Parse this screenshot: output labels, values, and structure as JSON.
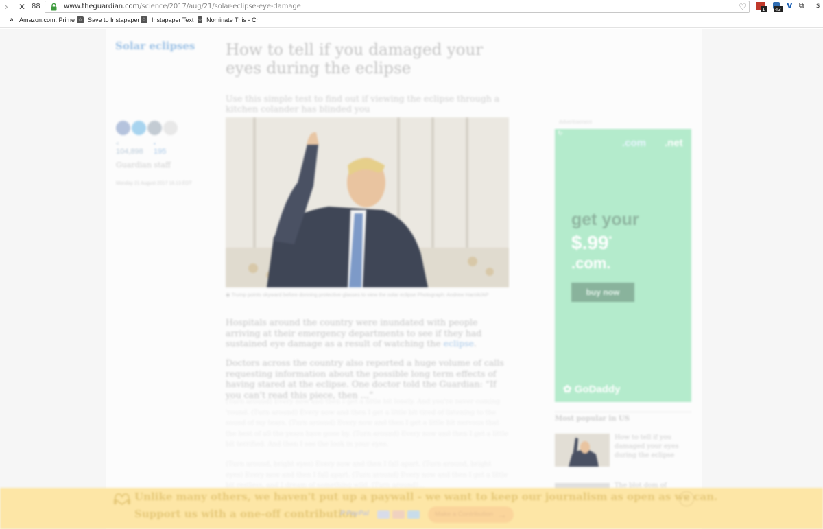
{
  "browser": {
    "url_host": "www.theguardian.com",
    "url_path": "/science/2017/aug/21/solar-eclipse-eye-damage",
    "ext_badges": [
      "1",
      "43",
      "",
      ""
    ],
    "bookmarks": [
      {
        "label": "Amazon.com: Prime",
        "icon": "a"
      },
      {
        "label": "Save to Instapaper",
        "icon": "☆"
      },
      {
        "label": "Instapaper Text",
        "icon": "☆"
      },
      {
        "label": "Nominate This - Chi",
        "icon": "☆"
      }
    ]
  },
  "article": {
    "section": "Solar eclipses",
    "headline": "How to tell if you damaged your eyes during the eclipse",
    "standfirst": "Use this simple test to find out if viewing the eclipse through a kitchen colander has blinded you",
    "shares": "104,898",
    "comments": "195",
    "byline": "Guardian staff",
    "date": "Monday 21 August 2017 16.13 EDT",
    "caption": "Trump points skyward before donning protective glasses to view the solar eclipse Photograph: Andrew Harnik/AP",
    "p1_before": "Hospitals around the country were inundated with people arriving at their emergency departments to see if they had sustained eye damage as a result of watching the ",
    "p1_link": "eclipse",
    "p1_after": ".",
    "p2": "Doctors across the country also reported a huge volume of calls requesting information about the possible long term effects of having stared at the eclipse. One doctor told the Guardian: “If you can’t read this piece, then …”",
    "p3": "(Turn around) Every now and then I get a little bit lonely. And you're never coming 'round. (Turn around) Every now and then I get a little bit tired of listening to the sound of my tears. (Turn around) Every now and then I get a little bit nervous that the best of all the years have gone by. (Turn around) Every now and then I get a little bit terrified. And then I see the look in your eyes.",
    "p4": "(Turn around, bright eyes) Every now and then I fall apart. (Turn around, bright eyes) Every now and then I fall apart. (Turn around) Every now and then I get a little bit restless, and I dream of something wild. (Turn around)..."
  },
  "ad": {
    "label": "Advertisement",
    "com": ".com",
    "net": ".net",
    "line1": "get your",
    "price": "$.99",
    "price_sup": "*",
    "tld": ".com.",
    "button": "buy now",
    "brand": "GoDaddy"
  },
  "most_popular": {
    "title": "Most popular in US",
    "items": [
      "How to tell if you damaged your eyes during the eclipse",
      "The blot dom of"
    ]
  },
  "banner": {
    "line1": "Unlike many others, we haven't put up a paywall - we want to keep our journalism as open as we can.",
    "line2": "Support us with a one-off contribution",
    "paypal": "PayPal",
    "button": "Make a Contribution",
    "close": "✕"
  },
  "colors": {
    "section_blue": "#9fc3e6",
    "ad_green": "#b4ebcc",
    "banner_yellow": "#fde6a6"
  }
}
